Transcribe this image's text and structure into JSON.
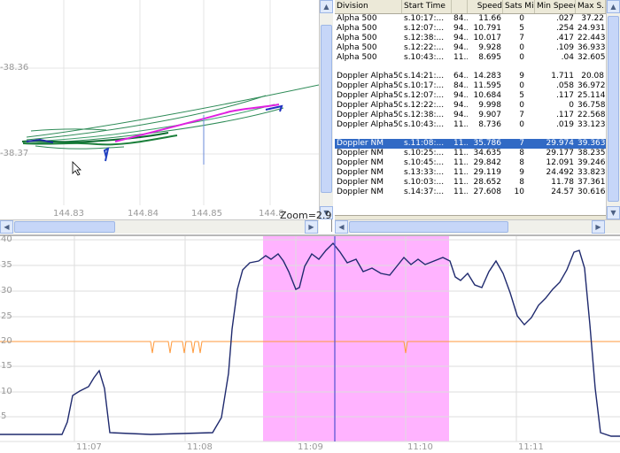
{
  "map": {
    "x_ticks": [
      "144.83",
      "144.84",
      "144.85",
      "144.8"
    ],
    "y_ticks": [
      "-38.36",
      "-38.37"
    ],
    "zoom_label": "Zoom=2.9"
  },
  "table": {
    "columns": [
      "Division",
      "Start Time",
      "",
      "Speed",
      "Sats Min",
      "Min Speed",
      "Max S..."
    ],
    "groups": [
      [
        {
          "division": "Alpha 500",
          "start": "s.10:17:...",
          "a": "84...",
          "speed": "11.66",
          "sats": "0",
          "min": ".027",
          "max": "37.22"
        },
        {
          "division": "Alpha 500",
          "start": "s.12:07:...",
          "a": "94...",
          "speed": "10.791",
          "sats": "5",
          "min": ".254",
          "max": "24.931"
        },
        {
          "division": "Alpha 500",
          "start": "s.12:38:...",
          "a": "94...",
          "speed": "10.017",
          "sats": "7",
          "min": ".417",
          "max": "22.443"
        },
        {
          "division": "Alpha 500",
          "start": "s.12:22:...",
          "a": "94...",
          "speed": "9.928",
          "sats": "0",
          "min": ".109",
          "max": "36.933"
        },
        {
          "division": "Alpha 500",
          "start": "s.10:43:...",
          "a": "11...",
          "speed": "8.695",
          "sats": "0",
          "min": ".04",
          "max": "32.605"
        }
      ],
      [
        {
          "division": "Doppler Alpha500",
          "start": "s.14:21:...",
          "a": "64...",
          "speed": "14.283",
          "sats": "9",
          "min": "1.711",
          "max": "20.08"
        },
        {
          "division": "Doppler Alpha500",
          "start": "s.10:17:...",
          "a": "84...",
          "speed": "11.595",
          "sats": "0",
          "min": ".058",
          "max": "36.972"
        },
        {
          "division": "Doppler Alpha500",
          "start": "s.12:07:...",
          "a": "94...",
          "speed": "10.684",
          "sats": "5",
          "min": ".117",
          "max": "25.114"
        },
        {
          "division": "Doppler Alpha500",
          "start": "s.12:22:...",
          "a": "94...",
          "speed": "9.998",
          "sats": "0",
          "min": "0",
          "max": "36.758"
        },
        {
          "division": "Doppler Alpha500",
          "start": "s.12:38:...",
          "a": "94...",
          "speed": "9.907",
          "sats": "7",
          "min": ".117",
          "max": "22.568"
        },
        {
          "division": "Doppler Alpha500",
          "start": "s.10:43:...",
          "a": "11...",
          "speed": "8.736",
          "sats": "0",
          "min": ".019",
          "max": "33.123"
        }
      ],
      [
        {
          "division": "Doppler NM",
          "start": "s.11:08:...",
          "a": "11...",
          "speed": "35.786",
          "sats": "7",
          "min": "29.974",
          "max": "39.363",
          "selected": true
        },
        {
          "division": "Doppler NM",
          "start": "s.10:25:...",
          "a": "11...",
          "speed": "34.635",
          "sats": "8",
          "min": "29.177",
          "max": "38.235"
        },
        {
          "division": "Doppler NM",
          "start": "s.10:45:...",
          "a": "11...",
          "speed": "29.842",
          "sats": "8",
          "min": "12.091",
          "max": "39.246"
        },
        {
          "division": "Doppler NM",
          "start": "s.13:33:...",
          "a": "11...",
          "speed": "29.119",
          "sats": "9",
          "min": "24.492",
          "max": "33.823"
        },
        {
          "division": "Doppler NM",
          "start": "s.10:03:...",
          "a": "11...",
          "speed": "28.652",
          "sats": "8",
          "min": "11.78",
          "max": "37.361"
        },
        {
          "division": "Doppler NM",
          "start": "s.14:37:...",
          "a": "11...",
          "speed": "27.608",
          "sats": "10",
          "min": "24.57",
          "max": "30.616"
        }
      ]
    ]
  },
  "chart": {
    "y_ticks": [
      "40",
      "35",
      "30",
      "25",
      "20",
      "15",
      "10",
      "5"
    ],
    "x_ticks": [
      "11:07",
      "11:08",
      "11:09",
      "11:10",
      "11:11"
    ],
    "colors": {
      "speed_line": "#1f2a6e",
      "threshold_line": "#ff9a3c",
      "selection": "#ffb3ff",
      "cursor": "#5050d0"
    }
  }
}
